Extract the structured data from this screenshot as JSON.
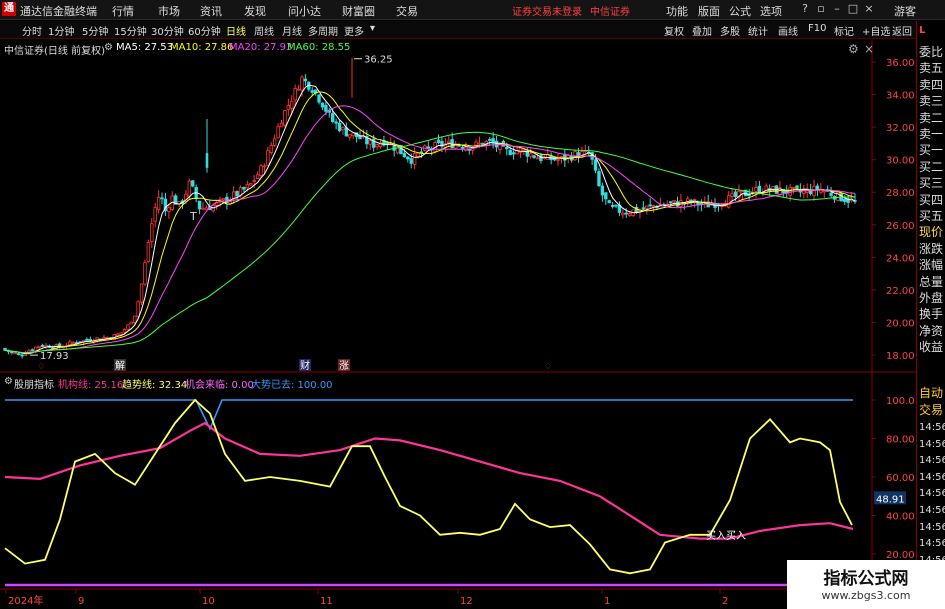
{
  "app": {
    "title": "通达信金融终端",
    "menu": [
      "行情",
      "市场",
      "资讯",
      "发现",
      "问小达",
      "财富圈",
      "交易"
    ],
    "notice_login": "证券交易未登录",
    "notice_broker": "中信证券",
    "right_menu": [
      "功能",
      "版面",
      "公式",
      "选项"
    ],
    "user": "游客",
    "logo_text": "通"
  },
  "toolbar": {
    "periods": [
      "分时",
      "1分钟",
      "5分钟",
      "15分钟",
      "30分钟",
      "60分钟",
      "日线",
      "周线",
      "月线",
      "多周期",
      "更多"
    ],
    "active_period": "日线",
    "right_buttons": [
      "复权",
      "叠加",
      "多股",
      "统计",
      "画线",
      "F10",
      "标记",
      "+自选",
      "返回"
    ]
  },
  "chart": {
    "header": "中信证券(日线 前复权)",
    "ma": [
      {
        "label": "MA5: 27.53",
        "color": "#ffffff"
      },
      {
        "label": "MA10: 27.86",
        "color": "#ffff00"
      },
      {
        "label": "MA20: 27.93",
        "color": "#ff44ff"
      },
      {
        "label": "MA60: 28.55",
        "color": "#44ff44"
      }
    ],
    "high_label": "36.25",
    "low_label": "17.93",
    "t_marker": "T",
    "y_ticks": [
      "36.00",
      "34.00",
      "32.00",
      "30.00",
      "28.00",
      "26.00",
      "24.00",
      "22.00",
      "20.00",
      "18.00"
    ],
    "events": [
      {
        "label": "解",
        "color": "#ffffff",
        "bg": "#333"
      },
      {
        "label": "财",
        "color": "#ffffff",
        "bg": "#226"
      },
      {
        "label": "涨",
        "color": "#ffffff",
        "bg": "#622"
      }
    ],
    "event_small": [
      "♢",
      "♢"
    ],
    "indicator_name": "股朋指标",
    "indicator": [
      {
        "label": "机构线: 25.16",
        "color": "#ff3399"
      },
      {
        "label": "趋势线: 32.34",
        "color": "#ffff66"
      },
      {
        "label": "机会来临: 0.00",
        "color": "#ff66ff"
      },
      {
        "label": "大势已去: 100.00",
        "color": "#3399ff"
      }
    ],
    "ind_ticks": [
      "100.0",
      "80.00",
      "60.00",
      "40.00",
      "20.00"
    ],
    "ind_current": "48.91",
    "buy_label": "买入买入",
    "x_axis": [
      "2024年",
      "9",
      "10",
      "11",
      "12",
      "1",
      "2"
    ]
  },
  "right_panel": {
    "labels": [
      "委比",
      "卖五",
      "卖四",
      "卖三",
      "卖二",
      "卖一",
      "买一",
      "买二",
      "买三",
      "买四",
      "买五",
      "现价",
      "涨跌",
      "涨幅",
      "总量",
      "外盘",
      "换手",
      "净资",
      "收益"
    ],
    "bottom_labels": [
      "自动",
      "交易"
    ],
    "times": [
      "14:56",
      "14:56",
      "14:56",
      "14:56",
      "14:56",
      "14:56",
      "14:56",
      "14:56",
      "14:56"
    ],
    "top_mark": "L"
  },
  "watermark": {
    "line1": "指标公式网",
    "line2": "www.zbgs3.com"
  },
  "colors": {
    "up": "#ff3333",
    "down": "#33dddd",
    "border": "#880000",
    "ma5": "#ffffff",
    "ma10": "#ffff00",
    "ma20": "#ff44ff",
    "ma60": "#44ff44"
  }
}
